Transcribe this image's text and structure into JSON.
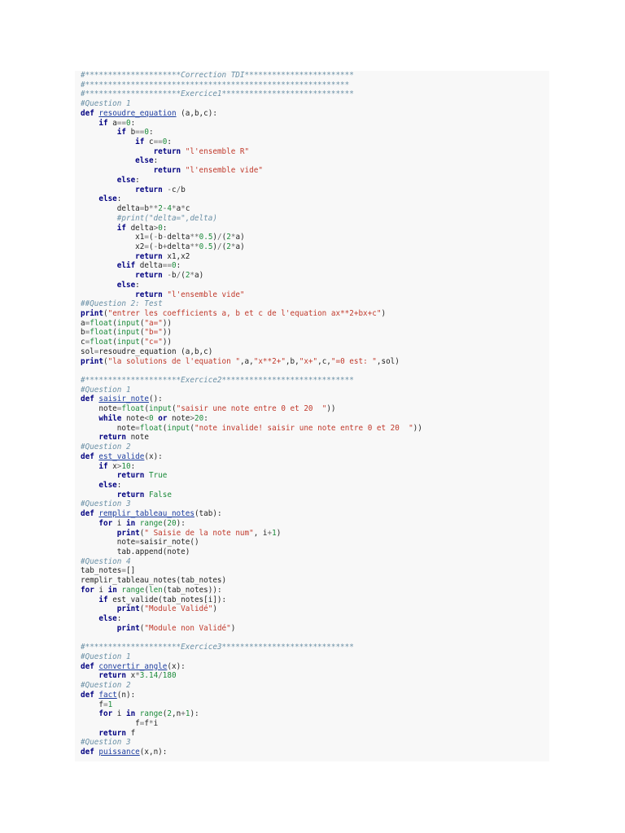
{
  "colors": {
    "background": "#f8f8f8",
    "comment": "#6a8fa5",
    "keyword": "#000080",
    "string": "#c0392b",
    "number": "#1b8a3a",
    "function_name": "#1f3fa0"
  },
  "lines": [
    [
      {
        "t": "c",
        "v": "#*********************Correction TDI************************"
      }
    ],
    [
      {
        "t": "c",
        "v": "#**********************************************************"
      }
    ],
    [
      {
        "t": "c",
        "v": "#*********************Exercice1*****************************"
      }
    ],
    [
      {
        "t": "c",
        "v": "#Question 1"
      }
    ],
    [
      {
        "t": "k",
        "v": "def"
      },
      {
        "t": "p",
        "v": " "
      },
      {
        "t": "f",
        "v": "resoudre_equation"
      },
      {
        "t": "p",
        "v": " (a,b,c):"
      }
    ],
    [
      {
        "t": "p",
        "v": "    "
      },
      {
        "t": "k",
        "v": "if"
      },
      {
        "t": "p",
        "v": " a"
      },
      {
        "t": "o",
        "v": "=="
      },
      {
        "t": "n",
        "v": "0"
      },
      {
        "t": "p",
        "v": ":"
      }
    ],
    [
      {
        "t": "p",
        "v": "        "
      },
      {
        "t": "k",
        "v": "if"
      },
      {
        "t": "p",
        "v": " b"
      },
      {
        "t": "o",
        "v": "=="
      },
      {
        "t": "n",
        "v": "0"
      },
      {
        "t": "p",
        "v": ":"
      }
    ],
    [
      {
        "t": "p",
        "v": "            "
      },
      {
        "t": "k",
        "v": "if"
      },
      {
        "t": "p",
        "v": " c"
      },
      {
        "t": "o",
        "v": "=="
      },
      {
        "t": "n",
        "v": "0"
      },
      {
        "t": "p",
        "v": ":"
      }
    ],
    [
      {
        "t": "p",
        "v": "                "
      },
      {
        "t": "k",
        "v": "return"
      },
      {
        "t": "p",
        "v": " "
      },
      {
        "t": "s",
        "v": "\"l'ensemble R\""
      }
    ],
    [
      {
        "t": "p",
        "v": "            "
      },
      {
        "t": "k",
        "v": "else"
      },
      {
        "t": "p",
        "v": ":"
      }
    ],
    [
      {
        "t": "p",
        "v": "                "
      },
      {
        "t": "k",
        "v": "return"
      },
      {
        "t": "p",
        "v": " "
      },
      {
        "t": "s",
        "v": "\"l'ensemble vide\""
      }
    ],
    [
      {
        "t": "p",
        "v": "        "
      },
      {
        "t": "k",
        "v": "else"
      },
      {
        "t": "p",
        "v": ":"
      }
    ],
    [
      {
        "t": "p",
        "v": "            "
      },
      {
        "t": "k",
        "v": "return"
      },
      {
        "t": "p",
        "v": " "
      },
      {
        "t": "o",
        "v": "-"
      },
      {
        "t": "p",
        "v": "c"
      },
      {
        "t": "o",
        "v": "/"
      },
      {
        "t": "p",
        "v": "b"
      }
    ],
    [
      {
        "t": "p",
        "v": "    "
      },
      {
        "t": "k",
        "v": "else"
      },
      {
        "t": "p",
        "v": ":"
      }
    ],
    [
      {
        "t": "p",
        "v": "        delta"
      },
      {
        "t": "o",
        "v": "="
      },
      {
        "t": "p",
        "v": "b"
      },
      {
        "t": "o",
        "v": "**"
      },
      {
        "t": "n",
        "v": "2"
      },
      {
        "t": "o",
        "v": "-"
      },
      {
        "t": "n",
        "v": "4"
      },
      {
        "t": "o",
        "v": "*"
      },
      {
        "t": "p",
        "v": "a"
      },
      {
        "t": "o",
        "v": "*"
      },
      {
        "t": "p",
        "v": "c"
      }
    ],
    [
      {
        "t": "p",
        "v": "        "
      },
      {
        "t": "c",
        "v": "#print(\"delta=\",delta)"
      }
    ],
    [
      {
        "t": "p",
        "v": "        "
      },
      {
        "t": "k",
        "v": "if"
      },
      {
        "t": "p",
        "v": " delta"
      },
      {
        "t": "o",
        "v": ">"
      },
      {
        "t": "n",
        "v": "0"
      },
      {
        "t": "p",
        "v": ":"
      }
    ],
    [
      {
        "t": "p",
        "v": "            x1"
      },
      {
        "t": "o",
        "v": "="
      },
      {
        "t": "p",
        "v": "("
      },
      {
        "t": "o",
        "v": "-"
      },
      {
        "t": "p",
        "v": "b"
      },
      {
        "t": "o",
        "v": "-"
      },
      {
        "t": "p",
        "v": "delta"
      },
      {
        "t": "o",
        "v": "**"
      },
      {
        "t": "n",
        "v": "0.5"
      },
      {
        "t": "p",
        "v": ")"
      },
      {
        "t": "o",
        "v": "/"
      },
      {
        "t": "p",
        "v": "("
      },
      {
        "t": "n",
        "v": "2"
      },
      {
        "t": "o",
        "v": "*"
      },
      {
        "t": "p",
        "v": "a)"
      }
    ],
    [
      {
        "t": "p",
        "v": "            x2"
      },
      {
        "t": "o",
        "v": "="
      },
      {
        "t": "p",
        "v": "("
      },
      {
        "t": "o",
        "v": "-"
      },
      {
        "t": "p",
        "v": "b"
      },
      {
        "t": "o",
        "v": "+"
      },
      {
        "t": "p",
        "v": "delta"
      },
      {
        "t": "o",
        "v": "**"
      },
      {
        "t": "n",
        "v": "0.5"
      },
      {
        "t": "p",
        "v": ")"
      },
      {
        "t": "o",
        "v": "/"
      },
      {
        "t": "p",
        "v": "("
      },
      {
        "t": "n",
        "v": "2"
      },
      {
        "t": "o",
        "v": "*"
      },
      {
        "t": "p",
        "v": "a)"
      }
    ],
    [
      {
        "t": "p",
        "v": "            "
      },
      {
        "t": "k",
        "v": "return"
      },
      {
        "t": "p",
        "v": " x1,x2"
      }
    ],
    [
      {
        "t": "p",
        "v": "        "
      },
      {
        "t": "k",
        "v": "elif"
      },
      {
        "t": "p",
        "v": " delta"
      },
      {
        "t": "o",
        "v": "=="
      },
      {
        "t": "n",
        "v": "0"
      },
      {
        "t": "p",
        "v": ":"
      }
    ],
    [
      {
        "t": "p",
        "v": "            "
      },
      {
        "t": "k",
        "v": "return"
      },
      {
        "t": "p",
        "v": " "
      },
      {
        "t": "o",
        "v": "-"
      },
      {
        "t": "p",
        "v": "b"
      },
      {
        "t": "o",
        "v": "/"
      },
      {
        "t": "p",
        "v": "("
      },
      {
        "t": "n",
        "v": "2"
      },
      {
        "t": "o",
        "v": "*"
      },
      {
        "t": "p",
        "v": "a)"
      }
    ],
    [
      {
        "t": "p",
        "v": "        "
      },
      {
        "t": "k",
        "v": "else"
      },
      {
        "t": "p",
        "v": ":"
      }
    ],
    [
      {
        "t": "p",
        "v": "            "
      },
      {
        "t": "k",
        "v": "return"
      },
      {
        "t": "p",
        "v": " "
      },
      {
        "t": "s",
        "v": "\"l'ensemble vide\""
      }
    ],
    [
      {
        "t": "c",
        "v": "##Question 2: Test"
      }
    ],
    [
      {
        "t": "k",
        "v": "print"
      },
      {
        "t": "p",
        "v": "("
      },
      {
        "t": "s",
        "v": "\"entrer les coefficients a, b et c de l'equation ax**2+bx+c\""
      },
      {
        "t": "p",
        "v": ")"
      }
    ],
    [
      {
        "t": "p",
        "v": "a"
      },
      {
        "t": "o",
        "v": "="
      },
      {
        "t": "b",
        "v": "float"
      },
      {
        "t": "p",
        "v": "("
      },
      {
        "t": "b",
        "v": "input"
      },
      {
        "t": "p",
        "v": "("
      },
      {
        "t": "s",
        "v": "\"a=\""
      },
      {
        "t": "p",
        "v": "))"
      }
    ],
    [
      {
        "t": "p",
        "v": "b"
      },
      {
        "t": "o",
        "v": "="
      },
      {
        "t": "b",
        "v": "float"
      },
      {
        "t": "p",
        "v": "("
      },
      {
        "t": "b",
        "v": "input"
      },
      {
        "t": "p",
        "v": "("
      },
      {
        "t": "s",
        "v": "\"b=\""
      },
      {
        "t": "p",
        "v": "))"
      }
    ],
    [
      {
        "t": "p",
        "v": "c"
      },
      {
        "t": "o",
        "v": "="
      },
      {
        "t": "b",
        "v": "float"
      },
      {
        "t": "p",
        "v": "("
      },
      {
        "t": "b",
        "v": "input"
      },
      {
        "t": "p",
        "v": "("
      },
      {
        "t": "s",
        "v": "\"c=\""
      },
      {
        "t": "p",
        "v": "))"
      }
    ],
    [
      {
        "t": "p",
        "v": "sol"
      },
      {
        "t": "o",
        "v": "="
      },
      {
        "t": "p",
        "v": "resoudre_equation (a,b,c)"
      }
    ],
    [
      {
        "t": "k",
        "v": "print"
      },
      {
        "t": "p",
        "v": "("
      },
      {
        "t": "s",
        "v": "\"la solutions de l'equation \""
      },
      {
        "t": "p",
        "v": ",a,"
      },
      {
        "t": "s",
        "v": "\"x**2+\""
      },
      {
        "t": "p",
        "v": ",b,"
      },
      {
        "t": "s",
        "v": "\"x+\""
      },
      {
        "t": "p",
        "v": ",c,"
      },
      {
        "t": "s",
        "v": "\"=0 est: \""
      },
      {
        "t": "p",
        "v": ",sol)"
      }
    ],
    [],
    [
      {
        "t": "c",
        "v": "#*********************Exercice2*****************************"
      }
    ],
    [
      {
        "t": "c",
        "v": "#Question 1"
      }
    ],
    [
      {
        "t": "k",
        "v": "def"
      },
      {
        "t": "p",
        "v": " "
      },
      {
        "t": "f",
        "v": "saisir_note"
      },
      {
        "t": "p",
        "v": "():"
      }
    ],
    [
      {
        "t": "p",
        "v": "    note"
      },
      {
        "t": "o",
        "v": "="
      },
      {
        "t": "b",
        "v": "float"
      },
      {
        "t": "p",
        "v": "("
      },
      {
        "t": "b",
        "v": "input"
      },
      {
        "t": "p",
        "v": "("
      },
      {
        "t": "s",
        "v": "\"saisir une note entre 0 et 20  \""
      },
      {
        "t": "p",
        "v": "))"
      }
    ],
    [
      {
        "t": "p",
        "v": "    "
      },
      {
        "t": "k",
        "v": "while"
      },
      {
        "t": "p",
        "v": " note"
      },
      {
        "t": "o",
        "v": "<"
      },
      {
        "t": "n",
        "v": "0"
      },
      {
        "t": "p",
        "v": " "
      },
      {
        "t": "k",
        "v": "or"
      },
      {
        "t": "p",
        "v": " note"
      },
      {
        "t": "o",
        "v": ">"
      },
      {
        "t": "n",
        "v": "20"
      },
      {
        "t": "p",
        "v": ":"
      }
    ],
    [
      {
        "t": "p",
        "v": "        note"
      },
      {
        "t": "o",
        "v": "="
      },
      {
        "t": "b",
        "v": "float"
      },
      {
        "t": "p",
        "v": "("
      },
      {
        "t": "b",
        "v": "input"
      },
      {
        "t": "p",
        "v": "("
      },
      {
        "t": "s",
        "v": "\"note invalide! saisir une note entre 0 et 20  \""
      },
      {
        "t": "p",
        "v": "))"
      }
    ],
    [
      {
        "t": "p",
        "v": "    "
      },
      {
        "t": "k",
        "v": "return"
      },
      {
        "t": "p",
        "v": " note"
      }
    ],
    [
      {
        "t": "c",
        "v": "#Question 2"
      }
    ],
    [
      {
        "t": "k",
        "v": "def"
      },
      {
        "t": "p",
        "v": " "
      },
      {
        "t": "f",
        "v": "est_valide"
      },
      {
        "t": "p",
        "v": "(x):"
      }
    ],
    [
      {
        "t": "p",
        "v": "    "
      },
      {
        "t": "k",
        "v": "if"
      },
      {
        "t": "p",
        "v": " x"
      },
      {
        "t": "o",
        "v": ">"
      },
      {
        "t": "n",
        "v": "10"
      },
      {
        "t": "p",
        "v": ":"
      }
    ],
    [
      {
        "t": "p",
        "v": "        "
      },
      {
        "t": "k",
        "v": "return"
      },
      {
        "t": "p",
        "v": " "
      },
      {
        "t": "b",
        "v": "True"
      }
    ],
    [
      {
        "t": "p",
        "v": "    "
      },
      {
        "t": "k",
        "v": "else"
      },
      {
        "t": "p",
        "v": ":"
      }
    ],
    [
      {
        "t": "p",
        "v": "        "
      },
      {
        "t": "k",
        "v": "return"
      },
      {
        "t": "p",
        "v": " "
      },
      {
        "t": "b",
        "v": "False"
      }
    ],
    [
      {
        "t": "c",
        "v": "#Question 3"
      }
    ],
    [
      {
        "t": "k",
        "v": "def"
      },
      {
        "t": "p",
        "v": " "
      },
      {
        "t": "f",
        "v": "remplir_tableau_notes"
      },
      {
        "t": "p",
        "v": "(tab):"
      }
    ],
    [
      {
        "t": "p",
        "v": "    "
      },
      {
        "t": "k",
        "v": "for"
      },
      {
        "t": "p",
        "v": " i "
      },
      {
        "t": "k",
        "v": "in"
      },
      {
        "t": "p",
        "v": " "
      },
      {
        "t": "b",
        "v": "range"
      },
      {
        "t": "p",
        "v": "("
      },
      {
        "t": "n",
        "v": "20"
      },
      {
        "t": "p",
        "v": "):"
      }
    ],
    [
      {
        "t": "p",
        "v": "        "
      },
      {
        "t": "k",
        "v": "print"
      },
      {
        "t": "p",
        "v": "("
      },
      {
        "t": "s",
        "v": "\" Saisie de la note num\""
      },
      {
        "t": "p",
        "v": ", i"
      },
      {
        "t": "o",
        "v": "+"
      },
      {
        "t": "n",
        "v": "1"
      },
      {
        "t": "p",
        "v": ")"
      }
    ],
    [
      {
        "t": "p",
        "v": "        note"
      },
      {
        "t": "o",
        "v": "="
      },
      {
        "t": "p",
        "v": "saisir_note()"
      }
    ],
    [
      {
        "t": "p",
        "v": "        tab.append(note)"
      }
    ],
    [
      {
        "t": "c",
        "v": "#Question 4"
      }
    ],
    [
      {
        "t": "p",
        "v": "tab_notes"
      },
      {
        "t": "o",
        "v": "="
      },
      {
        "t": "p",
        "v": "[]"
      }
    ],
    [
      {
        "t": "p",
        "v": "remplir_tableau_notes(tab_notes)"
      }
    ],
    [
      {
        "t": "k",
        "v": "for"
      },
      {
        "t": "p",
        "v": " i "
      },
      {
        "t": "k",
        "v": "in"
      },
      {
        "t": "p",
        "v": " "
      },
      {
        "t": "b",
        "v": "range"
      },
      {
        "t": "p",
        "v": "("
      },
      {
        "t": "b",
        "v": "len"
      },
      {
        "t": "p",
        "v": "(tab_notes)):"
      }
    ],
    [
      {
        "t": "p",
        "v": "    "
      },
      {
        "t": "k",
        "v": "if"
      },
      {
        "t": "p",
        "v": " est_valide(tab_notes[i]):"
      }
    ],
    [
      {
        "t": "p",
        "v": "        "
      },
      {
        "t": "k",
        "v": "print"
      },
      {
        "t": "p",
        "v": "("
      },
      {
        "t": "s",
        "v": "\"Module Validé\""
      },
      {
        "t": "p",
        "v": ")"
      }
    ],
    [
      {
        "t": "p",
        "v": "    "
      },
      {
        "t": "k",
        "v": "else"
      },
      {
        "t": "p",
        "v": ":"
      }
    ],
    [
      {
        "t": "p",
        "v": "        "
      },
      {
        "t": "k",
        "v": "print"
      },
      {
        "t": "p",
        "v": "("
      },
      {
        "t": "s",
        "v": "\"Module non Validé\""
      },
      {
        "t": "p",
        "v": ")"
      }
    ],
    [],
    [
      {
        "t": "c",
        "v": "#*********************Exercice3*****************************"
      }
    ],
    [
      {
        "t": "c",
        "v": "#Question 1"
      }
    ],
    [
      {
        "t": "k",
        "v": "def"
      },
      {
        "t": "p",
        "v": " "
      },
      {
        "t": "f",
        "v": "convertir_angle"
      },
      {
        "t": "p",
        "v": "(x):"
      }
    ],
    [
      {
        "t": "p",
        "v": "    "
      },
      {
        "t": "k",
        "v": "return"
      },
      {
        "t": "p",
        "v": " x"
      },
      {
        "t": "o",
        "v": "*"
      },
      {
        "t": "n",
        "v": "3.14"
      },
      {
        "t": "o",
        "v": "/"
      },
      {
        "t": "n",
        "v": "180"
      }
    ],
    [
      {
        "t": "c",
        "v": "#Question 2"
      }
    ],
    [
      {
        "t": "k",
        "v": "def"
      },
      {
        "t": "p",
        "v": " "
      },
      {
        "t": "f",
        "v": "fact"
      },
      {
        "t": "p",
        "v": "(n):"
      }
    ],
    [
      {
        "t": "p",
        "v": "    f"
      },
      {
        "t": "o",
        "v": "="
      },
      {
        "t": "n",
        "v": "1"
      }
    ],
    [
      {
        "t": "p",
        "v": "    "
      },
      {
        "t": "k",
        "v": "for"
      },
      {
        "t": "p",
        "v": " i "
      },
      {
        "t": "k",
        "v": "in"
      },
      {
        "t": "p",
        "v": " "
      },
      {
        "t": "b",
        "v": "range"
      },
      {
        "t": "p",
        "v": "("
      },
      {
        "t": "n",
        "v": "2"
      },
      {
        "t": "p",
        "v": ",n"
      },
      {
        "t": "o",
        "v": "+"
      },
      {
        "t": "n",
        "v": "1"
      },
      {
        "t": "p",
        "v": "):"
      }
    ],
    [
      {
        "t": "p",
        "v": "            f"
      },
      {
        "t": "o",
        "v": "="
      },
      {
        "t": "p",
        "v": "f"
      },
      {
        "t": "o",
        "v": "*"
      },
      {
        "t": "p",
        "v": "i"
      }
    ],
    [
      {
        "t": "p",
        "v": "    "
      },
      {
        "t": "k",
        "v": "return"
      },
      {
        "t": "p",
        "v": " f"
      }
    ],
    [
      {
        "t": "c",
        "v": "#Question 3"
      }
    ],
    [
      {
        "t": "k",
        "v": "def"
      },
      {
        "t": "p",
        "v": " "
      },
      {
        "t": "f",
        "v": "puissance"
      },
      {
        "t": "p",
        "v": "(x,n):"
      }
    ]
  ]
}
